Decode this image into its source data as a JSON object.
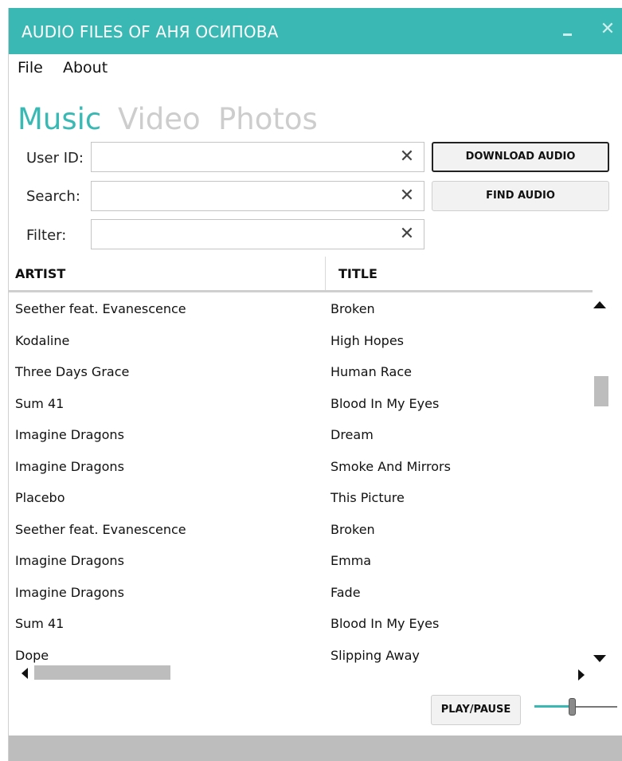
{
  "window": {
    "title": "AUDIO FILES OF АНЯ ОСИПОВА",
    "accent": "#3ab9b4",
    "minimize_icon": "minimize-icon",
    "close_glyph": "✕"
  },
  "menu": [
    "File",
    "About"
  ],
  "nav_tabs": [
    {
      "label": "Music",
      "active": true
    },
    {
      "label": "Video",
      "active": false
    },
    {
      "label": "Photos",
      "active": false
    }
  ],
  "form": {
    "user_id": {
      "label": "User ID:",
      "value": "",
      "placeholder": ""
    },
    "search": {
      "label": "Search:",
      "value": "",
      "placeholder": ""
    },
    "filter": {
      "label": "Filter:",
      "value": "",
      "placeholder": ""
    },
    "clear_glyph": "✕"
  },
  "buttons": {
    "download_audio": "DOWNLOAD AUDIO",
    "find_audio": "FIND AUDIO",
    "play_pause": "PLAY/PAUSE"
  },
  "table": {
    "columns": [
      "ARTIST",
      "TITLE"
    ],
    "rows": [
      [
        "Seether feat. Evanescence",
        "Broken"
      ],
      [
        "Kodaline",
        "High Hopes"
      ],
      [
        "Three Days Grace",
        "Human Race"
      ],
      [
        "Sum 41",
        "Blood In My Eyes"
      ],
      [
        "Imagine Dragons",
        "Dream"
      ],
      [
        "Imagine Dragons",
        "Smoke And Mirrors"
      ],
      [
        "Placebo",
        "This Picture"
      ],
      [
        "Seether feat. Evanescence",
        "Broken"
      ],
      [
        "Imagine Dragons",
        "Emma"
      ],
      [
        "Imagine Dragons",
        "Fade"
      ],
      [
        "Sum 41",
        "Blood In My Eyes"
      ],
      [
        "Dope",
        "Slipping Away"
      ]
    ]
  },
  "volume": {
    "level": 0.45
  }
}
